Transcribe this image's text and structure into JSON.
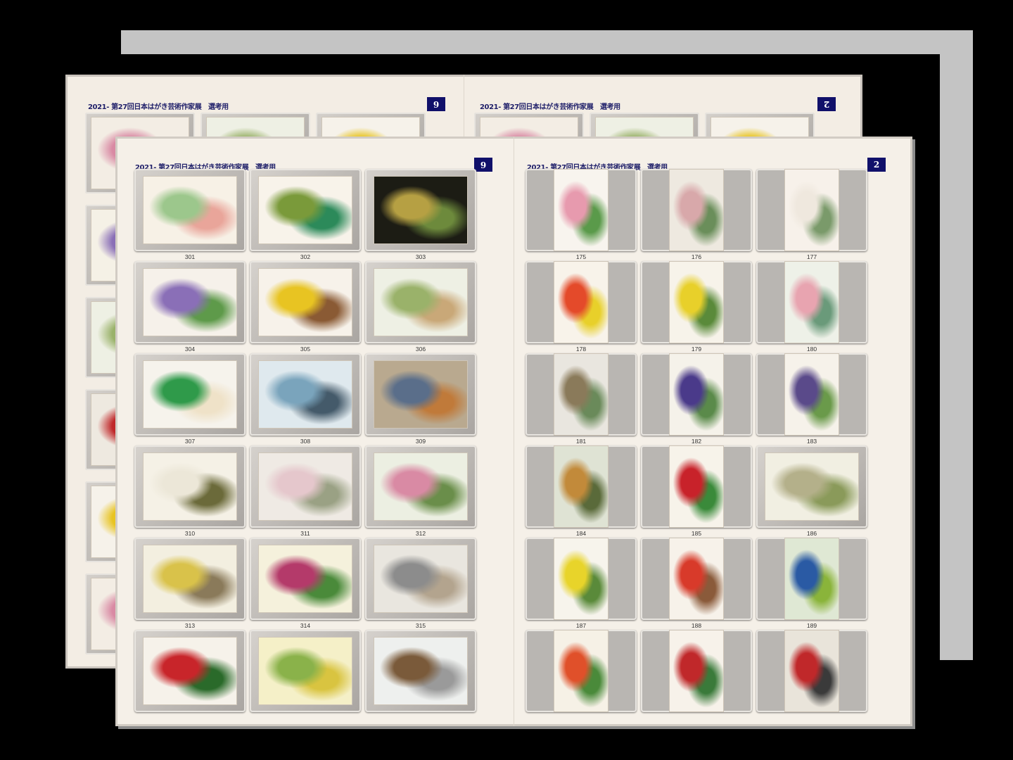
{
  "back_spread": {
    "left_page": {
      "header": "2021- 第27回日本はがき芸術作家展　選考用",
      "page_number": "6"
    },
    "right_page": {
      "header": "2021- 第27回日本はがき芸術作家展　選考用",
      "page_number": "2"
    }
  },
  "front_spread": {
    "left_page": {
      "header": "2021- 第27回日本はがき芸術作家展　選考用",
      "page_number": "6",
      "items": [
        {
          "number": "301",
          "subject": "girl-with-calendar",
          "colors": [
            "#f7f1e6",
            "#9cc78c",
            "#e9a59a"
          ]
        },
        {
          "number": "302",
          "subject": "tea-and-kashiwa-mochi",
          "colors": [
            "#f8f3ea",
            "#7a9a3a",
            "#2c8a5a"
          ]
        },
        {
          "number": "303",
          "subject": "tunnel-autumn-leaves",
          "colors": [
            "#1c1c14",
            "#b6a043",
            "#6d8a3c"
          ]
        },
        {
          "number": "304",
          "subject": "hydrangea",
          "colors": [
            "#f6f1ea",
            "#8a6fb7",
            "#5e9a4a"
          ]
        },
        {
          "number": "305",
          "subject": "yellow-flowers-in-basket",
          "colors": [
            "#f7f2ea",
            "#e8c422",
            "#8a5a34"
          ]
        },
        {
          "number": "306",
          "subject": "shrine-walk-landscape",
          "colors": [
            "#eef0e4",
            "#9ab26a",
            "#c9a878"
          ]
        },
        {
          "number": "307",
          "subject": "white-camellia",
          "colors": [
            "#f6f3ec",
            "#2f9a4a",
            "#efe2c8"
          ]
        },
        {
          "number": "308",
          "subject": "sailboats-harbor",
          "colors": [
            "#dfe9ee",
            "#7aa4bc",
            "#445a6a"
          ]
        },
        {
          "number": "309",
          "subject": "tanuki-figure",
          "colors": [
            "#b9a98f",
            "#5a6e8a",
            "#c07a3a"
          ]
        },
        {
          "number": "310",
          "subject": "dogwood-blossoms",
          "colors": [
            "#f5f1e6",
            "#ece7d8",
            "#6b6a3a"
          ]
        },
        {
          "number": "311",
          "subject": "cherry-blossom-temple",
          "colors": [
            "#efeae4",
            "#e5c7cc",
            "#9aa184"
          ]
        },
        {
          "number": "312",
          "subject": "spring-garden",
          "colors": [
            "#ecefe2",
            "#d98aa4",
            "#6a8e4a"
          ]
        },
        {
          "number": "313",
          "subject": "old-house-ginkgo",
          "colors": [
            "#f3efe0",
            "#d9c24a",
            "#8a7a5a"
          ]
        },
        {
          "number": "314",
          "subject": "pink-flowers",
          "colors": [
            "#f5f1dc",
            "#b43a6a",
            "#4a8a3a"
          ]
        },
        {
          "number": "315",
          "subject": "tall-sculpture",
          "colors": [
            "#e9e6df",
            "#8c8c8c",
            "#b3a48e"
          ]
        },
        {
          "number": "",
          "subject": "red-camellia",
          "colors": [
            "#f6f2ea",
            "#c8252a",
            "#2a6a2a"
          ]
        },
        {
          "number": "",
          "subject": "green-plant-yellow",
          "colors": [
            "#f5f0c8",
            "#8ab24a",
            "#d9c440"
          ]
        },
        {
          "number": "",
          "subject": "temple-festival-crowd",
          "colors": [
            "#eef0ee",
            "#7a5a3a",
            "#9a9a9a"
          ]
        }
      ]
    },
    "right_page": {
      "header": "2021- 第27回日本はがき芸術作家展　選考用",
      "page_number": "2",
      "items": [
        {
          "number": "175",
          "subject": "pink-geranium",
          "colors": [
            "#f8f4ee",
            "#e79aae",
            "#5a9a4a"
          ],
          "orientation": "portrait"
        },
        {
          "number": "176",
          "subject": "mountain-valley",
          "colors": [
            "#eee9e0",
            "#d8a8aa",
            "#6a8e5a"
          ],
          "orientation": "portrait"
        },
        {
          "number": "177",
          "subject": "white-flowers-calligraphy",
          "colors": [
            "#f7f1ea",
            "#efe8de",
            "#7a9a6a"
          ],
          "orientation": "portrait"
        },
        {
          "number": "178",
          "subject": "tulips-calligraphy",
          "colors": [
            "#f8f3ea",
            "#e44a2a",
            "#e8d02a"
          ],
          "orientation": "portrait"
        },
        {
          "number": "179",
          "subject": "yellow-flower-calligraphy",
          "colors": [
            "#f7f3ea",
            "#e8d02a",
            "#5a8a3a"
          ],
          "orientation": "portrait"
        },
        {
          "number": "180",
          "subject": "pink-cactus-flower",
          "colors": [
            "#eef1e8",
            "#e8a4b0",
            "#6a9a7a"
          ],
          "orientation": "portrait"
        },
        {
          "number": "181",
          "subject": "pagoda-street",
          "colors": [
            "#e9e6df",
            "#8a7a5a",
            "#6a8a5a"
          ],
          "orientation": "portrait"
        },
        {
          "number": "182",
          "subject": "purple-bellflowers",
          "colors": [
            "#f5f2ea",
            "#4a3a8a",
            "#5a8a4a"
          ],
          "orientation": "portrait"
        },
        {
          "number": "183",
          "subject": "iris",
          "colors": [
            "#f6f2ea",
            "#5a4a8a",
            "#6a9a4a"
          ],
          "orientation": "portrait"
        },
        {
          "number": "184",
          "subject": "gate-autumn",
          "colors": [
            "#dfe3d4",
            "#c28a3a",
            "#5a6a3a"
          ],
          "orientation": "portrait"
        },
        {
          "number": "185",
          "subject": "red-berries",
          "colors": [
            "#f7f3ea",
            "#c8222a",
            "#3a8a3a"
          ],
          "orientation": "portrait"
        },
        {
          "number": "186",
          "subject": "bamboo-shoot",
          "colors": [
            "#f1efe2",
            "#b4b08a",
            "#8a9a5a"
          ],
          "orientation": "landscape"
        },
        {
          "number": "187",
          "subject": "narcissus-calligraphy",
          "colors": [
            "#f7f4ec",
            "#e8d42a",
            "#5a8a3a"
          ],
          "orientation": "portrait"
        },
        {
          "number": "188",
          "subject": "pomegranate",
          "colors": [
            "#f7f2ea",
            "#d83a2a",
            "#8a5a3a"
          ],
          "orientation": "portrait"
        },
        {
          "number": "189",
          "subject": "house-field-blue-sky",
          "colors": [
            "#dfe8d4",
            "#2a5aa4",
            "#8ab43a"
          ],
          "orientation": "portrait"
        },
        {
          "number": "",
          "subject": "strawberry",
          "colors": [
            "#f6f1e6",
            "#e0502a",
            "#4a8a3a"
          ],
          "orientation": "portrait"
        },
        {
          "number": "",
          "subject": "red-rose",
          "colors": [
            "#f7f2ea",
            "#c0282a",
            "#3a7a3a"
          ],
          "orientation": "portrait"
        },
        {
          "number": "",
          "subject": "red-hat-figure",
          "colors": [
            "#e9e4da",
            "#c0282a",
            "#3a3a3a"
          ],
          "orientation": "portrait"
        }
      ]
    }
  }
}
